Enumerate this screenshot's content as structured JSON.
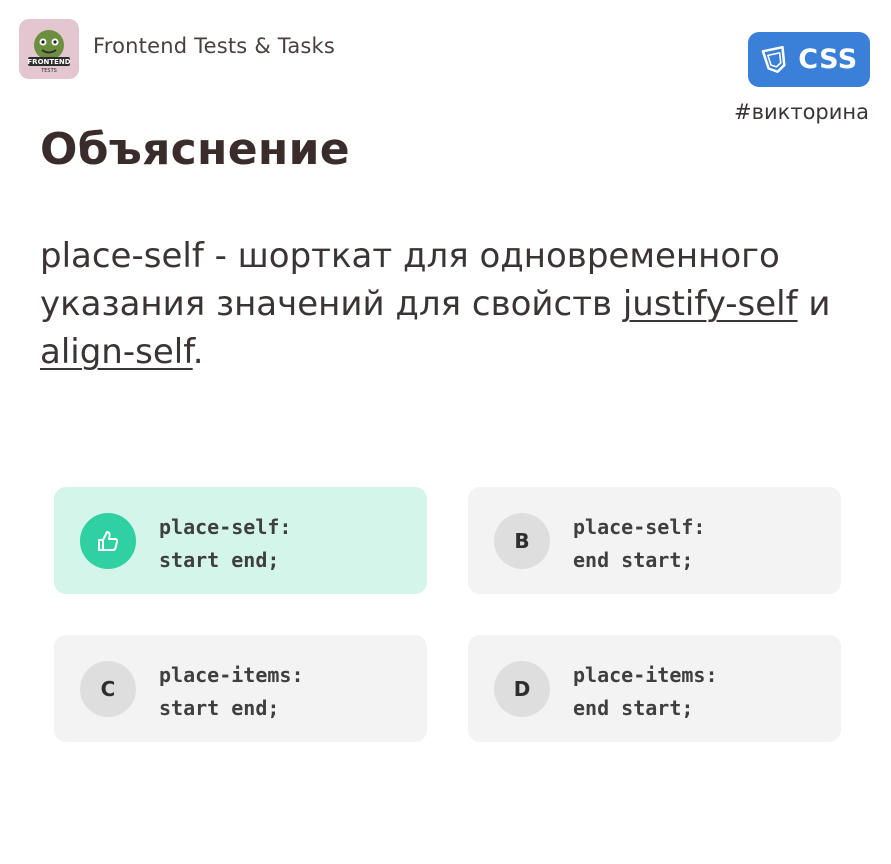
{
  "header": {
    "logo_icon": "frontend-tests-logo",
    "brand_name": "Frontend Tests & Tasks",
    "badge_icon": "css-shield-icon",
    "badge_label": "CSS",
    "hashtag": "#викторина"
  },
  "title": "Объяснение",
  "explanation": {
    "part1": "place-self - шорткат для одновременного указания значений для свойств ",
    "link1": "justify-self",
    "part2": " и ",
    "link2": "align-self",
    "part3": "."
  },
  "options": [
    {
      "marker": "",
      "marker_icon": "thumbs-up-icon",
      "line1": "place-self:",
      "line2": "start end;",
      "correct": true
    },
    {
      "marker": "B",
      "line1": "place-self:",
      "line2": "end start;",
      "correct": false
    },
    {
      "marker": "C",
      "line1": "place-items:",
      "line2": "start end;",
      "correct": false
    },
    {
      "marker": "D",
      "line1": "place-items:",
      "line2": "end start;",
      "correct": false
    }
  ],
  "colors": {
    "badge": "#3a80d9",
    "correct_bg": "#d3f5ea",
    "correct_marker": "#2fd0a1",
    "card_bg": "#f3f3f3"
  }
}
